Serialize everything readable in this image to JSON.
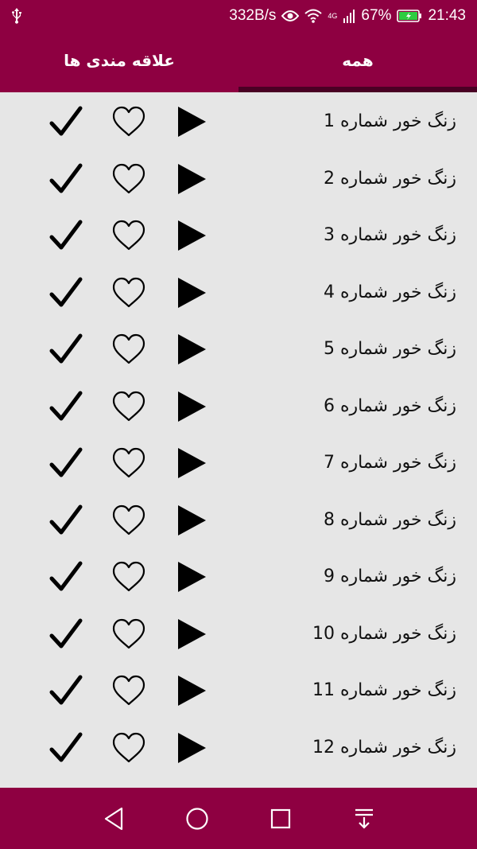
{
  "status_bar": {
    "usb_icon": "usb-icon",
    "net_speed": "332B/s",
    "signal_badge": "4G",
    "battery_percent": "67%",
    "time": "21:43"
  },
  "tabs": [
    {
      "label": "همه",
      "selected": true
    },
    {
      "label": "علاقه مندی ها",
      "selected": false
    }
  ],
  "list": {
    "items": [
      {
        "title": "زنگ خور شماره 1"
      },
      {
        "title": "زنگ خور شماره 2"
      },
      {
        "title": "زنگ خور شماره 3"
      },
      {
        "title": "زنگ خور شماره 4"
      },
      {
        "title": "زنگ خور شماره 5"
      },
      {
        "title": "زنگ خور شماره 6"
      },
      {
        "title": "زنگ خور شماره 7"
      },
      {
        "title": "زنگ خور شماره 8"
      },
      {
        "title": "زنگ خور شماره 9"
      },
      {
        "title": "زنگ خور شماره 10"
      },
      {
        "title": "زنگ خور شماره 11"
      },
      {
        "title": "زنگ خور شماره 12"
      }
    ]
  },
  "colors": {
    "primary": "#8e0041",
    "indicator": "#4a0024",
    "background": "#e6e6e6"
  },
  "navbar": {
    "icons": [
      "back-icon",
      "home-icon",
      "recents-icon",
      "notification-shade-icon"
    ]
  }
}
